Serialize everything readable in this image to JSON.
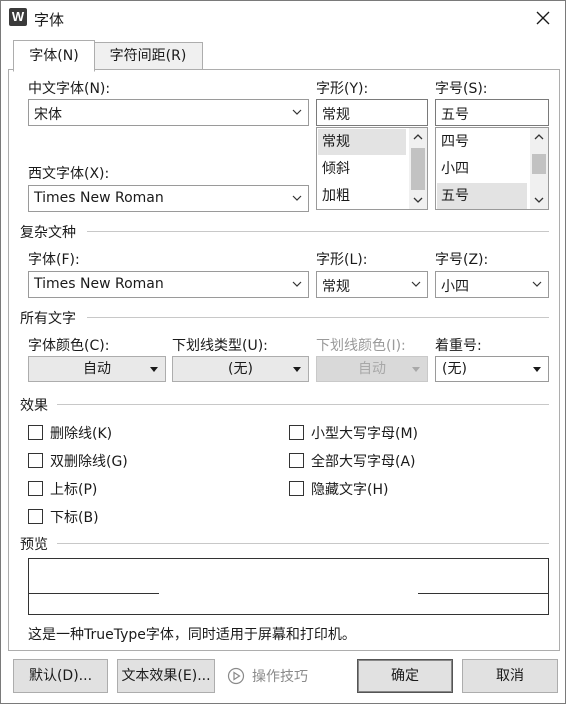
{
  "window": {
    "title": "字体",
    "app_icon_letter": "W"
  },
  "tabs": [
    {
      "label": "字体(N)",
      "active": true
    },
    {
      "label": "字符间距(R)",
      "active": false
    }
  ],
  "chinese_font": {
    "label": "中文字体(N):",
    "value": "宋体"
  },
  "font_style": {
    "label": "字形(Y):",
    "value": "常规",
    "options": [
      "常规",
      "倾斜",
      "加粗"
    ],
    "selected_index": 0
  },
  "font_size": {
    "label": "字号(S):",
    "value": "五号",
    "options": [
      "四号",
      "小四",
      "五号"
    ],
    "selected_index": 2
  },
  "western_font": {
    "label": "西文字体(X):",
    "value": "Times New Roman"
  },
  "complex_section": {
    "title": "复杂文种",
    "font_label": "字体(F):",
    "font_value": "Times New Roman",
    "style_label": "字形(L):",
    "style_value": "常规",
    "size_label": "字号(Z):",
    "size_value": "小四"
  },
  "all_text_section": {
    "title": "所有文字",
    "font_color_label": "字体颜色(C):",
    "font_color_value": "自动",
    "underline_type_label": "下划线类型(U):",
    "underline_type_value": "(无)",
    "underline_color_label": "下划线颜色(I):",
    "underline_color_value": "自动",
    "emphasis_label": "着重号:",
    "emphasis_value": "(无)"
  },
  "effects_section": {
    "title": "效果",
    "left": [
      "删除线(K)",
      "双删除线(G)",
      "上标(P)",
      "下标(B)"
    ],
    "right": [
      "小型大写字母(M)",
      "全部大写字母(A)",
      "隐藏文字(H)"
    ]
  },
  "preview_section": {
    "title": "预览",
    "note": "这是一种TrueType字体，同时适用于屏幕和打印机。"
  },
  "buttons": {
    "default": "默认(D)...",
    "text_effects": "文本效果(E)...",
    "tips": "操作技巧",
    "ok": "确定",
    "cancel": "取消"
  },
  "colors": {
    "dialog_bg": "#ffffff",
    "button_bg": "#e1e1e1",
    "selected_item_bg": "#e3e3e3"
  }
}
